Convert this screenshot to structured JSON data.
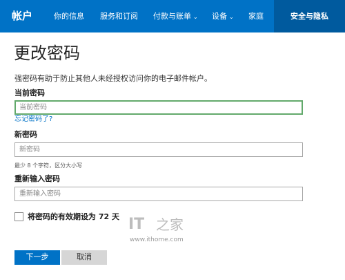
{
  "topnav": {
    "brand": "帐户",
    "items": [
      {
        "label": "你的信息",
        "caret": ""
      },
      {
        "label": "服务和订阅",
        "caret": ""
      },
      {
        "label": "付款与账单",
        "caret": "⌄"
      },
      {
        "label": "设备",
        "caret": "⌄"
      },
      {
        "label": "家庭",
        "caret": ""
      },
      {
        "label": "安全与隐私",
        "caret": ""
      }
    ],
    "active_index": 5,
    "color": "#0072c6",
    "active_color": "#005a9e"
  },
  "page": {
    "title": "更改密码",
    "description": "强密码有助于防止其他人未经授权访问你的电子邮件帐户。"
  },
  "current_password": {
    "label": "当前密码",
    "placeholder": "当前密码",
    "value": "",
    "forgot_link": "忘记密码了?"
  },
  "new_password": {
    "label": "新密码",
    "placeholder": "新密码",
    "value": "",
    "hint": "最少 8 个字符，区分大小写"
  },
  "confirm_password": {
    "label": "重新输入密码",
    "placeholder": "重新输入密码",
    "value": ""
  },
  "expiry_checkbox": {
    "label": "将密码的有效期设为 72 天",
    "checked": false
  },
  "watermark": {
    "logo_text": "IT",
    "logo_glyph": "之家",
    "url": "www.ithome.com"
  },
  "buttons": {
    "next": "下一步",
    "cancel": "取消"
  }
}
